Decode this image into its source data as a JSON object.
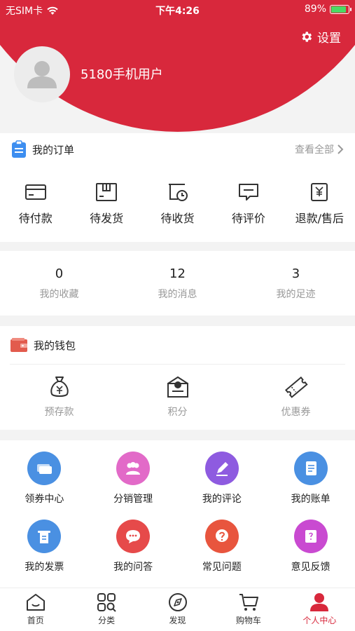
{
  "status_bar": {
    "carrier": "无SIM卡",
    "time": "下午4:26",
    "battery": "89%",
    "battery_level": 0.89
  },
  "profile": {
    "settings_label": "设置",
    "username": "5180手机用户"
  },
  "orders": {
    "title": "我的订单",
    "view_all": "查看全部",
    "items": [
      {
        "label": "待付款",
        "icon": "card-icon"
      },
      {
        "label": "待发货",
        "icon": "box-icon"
      },
      {
        "label": "待收货",
        "icon": "truck-clock-icon"
      },
      {
        "label": "待评价",
        "icon": "comment-icon"
      },
      {
        "label": "退款/售后",
        "icon": "refund-icon"
      }
    ]
  },
  "stats": [
    {
      "value": "0",
      "label": "我的收藏"
    },
    {
      "value": "12",
      "label": "我的消息"
    },
    {
      "value": "3",
      "label": "我的足迹"
    }
  ],
  "wallet": {
    "title": "我的钱包",
    "items": [
      {
        "label": "预存款",
        "icon": "money-bag-icon"
      },
      {
        "label": "积分",
        "icon": "points-icon"
      },
      {
        "label": "优惠券",
        "icon": "coupon-icon"
      }
    ]
  },
  "services": [
    {
      "label": "领券中心",
      "icon": "coupon-center-icon",
      "color": "#4a90e2"
    },
    {
      "label": "分销管理",
      "icon": "distribution-icon",
      "color": "#e26ac8"
    },
    {
      "label": "我的评论",
      "icon": "pencil-icon",
      "color": "#8e5be0"
    },
    {
      "label": "我的账单",
      "icon": "bill-icon",
      "color": "#4a90e2"
    },
    {
      "label": "我的发票",
      "icon": "invoice-icon",
      "color": "#4a90e2"
    },
    {
      "label": "我的问答",
      "icon": "chat-icon",
      "color": "#e64a4a"
    },
    {
      "label": "常见问题",
      "icon": "question-icon",
      "color": "#e8553e"
    },
    {
      "label": "意见反馈",
      "icon": "feedback-icon",
      "color": "#c94ad1"
    }
  ],
  "tabbar": [
    {
      "label": "首页",
      "icon": "home-icon"
    },
    {
      "label": "分类",
      "icon": "category-icon"
    },
    {
      "label": "发现",
      "icon": "compass-icon"
    },
    {
      "label": "购物车",
      "icon": "cart-icon"
    },
    {
      "label": "个人中心",
      "icon": "person-icon",
      "active": true
    }
  ],
  "colors": {
    "brand": "#d8283c",
    "muted": "#999999"
  }
}
